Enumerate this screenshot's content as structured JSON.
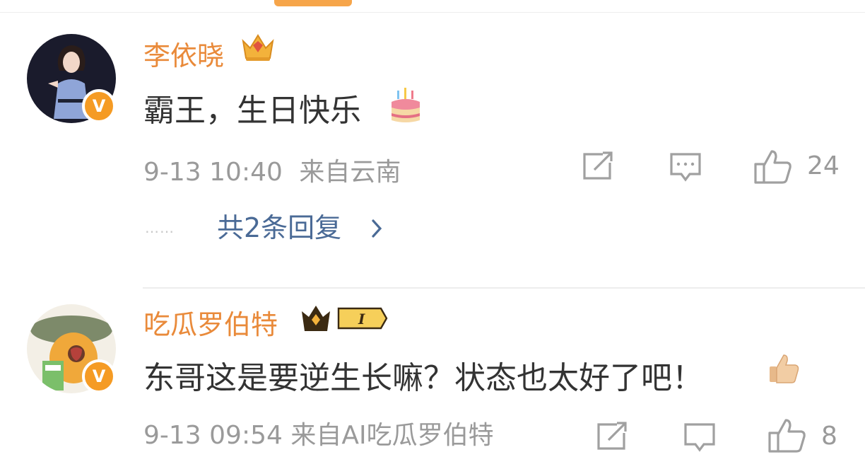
{
  "comments": [
    {
      "username": "李依晓",
      "text": "霸王，生日快乐",
      "emoji": "cake-emoji",
      "time": "9-13 10:40",
      "location": "来自云南",
      "likes": "24",
      "replies_label": "共2条回复",
      "replies_dots": "……"
    },
    {
      "username": "吃瓜罗伯特",
      "level_badge": "I",
      "text": "东哥这是要逆生长嘛？状态也太好了吧！",
      "emoji": "thumbs-up-emoji",
      "meta_partial": "9-13 09:54  来自AI吃瓜罗伯特",
      "likes_partial": "8"
    }
  ],
  "colors": {
    "username": "#e98a3a",
    "text": "#333333",
    "meta": "#9a9a9a",
    "link": "#4a6a96",
    "badge": "#f59b24"
  }
}
